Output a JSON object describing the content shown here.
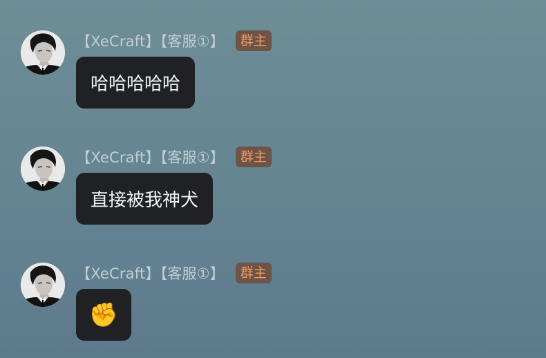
{
  "messages": [
    {
      "sender": "【XeCraft】【客服①】",
      "role_badge": "群主",
      "text": "哈哈哈哈哈"
    },
    {
      "sender": "【XeCraft】【客服①】",
      "role_badge": "群主",
      "text": "直接被我神犬"
    },
    {
      "sender": "【XeCraft】【客服①】",
      "role_badge": "群主",
      "text": "✊"
    }
  ],
  "colors": {
    "background": "#668593",
    "bubble": "#1f2124",
    "bubble_text": "#f2f2f2",
    "sender_text": "#c2ced3",
    "badge_bg": "#6e5447",
    "badge_text": "#ef9a62"
  },
  "icons": {
    "avatar": "user-photo-avatar"
  }
}
